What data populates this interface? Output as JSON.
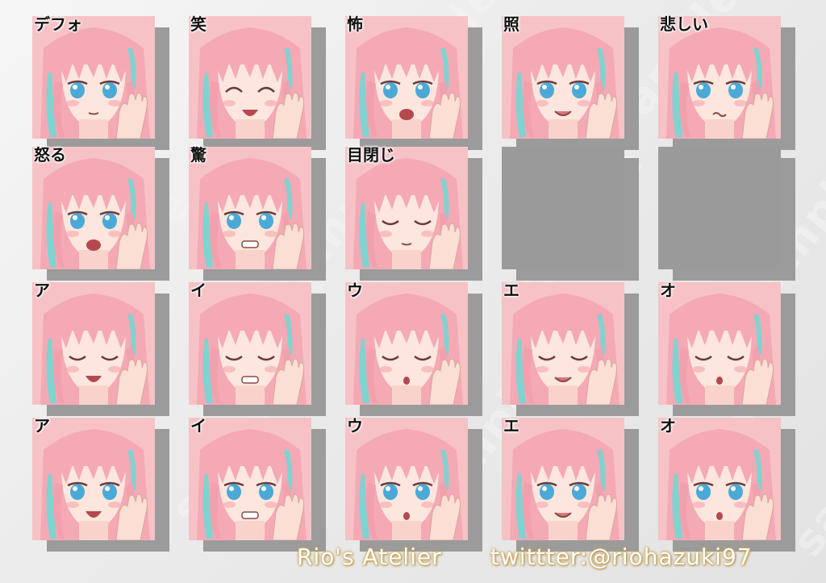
{
  "watermark_text": "sample",
  "faces": [
    {
      "label": "デフォ",
      "eyes": "open",
      "mouth": "small"
    },
    {
      "label": "笑",
      "eyes": "happy",
      "mouth": "open"
    },
    {
      "label": "怖",
      "eyes": "open",
      "mouth": "wide"
    },
    {
      "label": "照",
      "eyes": "open",
      "mouth": "smile"
    },
    {
      "label": "悲しい",
      "eyes": "open",
      "mouth": "wavy"
    },
    {
      "label": "怒る",
      "eyes": "open",
      "mouth": "wide"
    },
    {
      "label": "驚",
      "eyes": "open",
      "mouth": "teeth"
    },
    {
      "label": "目閉じ",
      "eyes": "closed",
      "mouth": "small"
    },
    {
      "label": "",
      "blank": true
    },
    {
      "label": "",
      "blank": true
    },
    {
      "label": "ア",
      "eyes": "closed",
      "mouth": "open"
    },
    {
      "label": "イ",
      "eyes": "closed",
      "mouth": "teeth"
    },
    {
      "label": "ウ",
      "eyes": "closed",
      "mouth": "o"
    },
    {
      "label": "エ",
      "eyes": "closed",
      "mouth": "smile"
    },
    {
      "label": "オ",
      "eyes": "closed",
      "mouth": "o"
    },
    {
      "label": "ア",
      "eyes": "open",
      "mouth": "open"
    },
    {
      "label": "イ",
      "eyes": "open",
      "mouth": "teeth"
    },
    {
      "label": "ウ",
      "eyes": "open",
      "mouth": "o"
    },
    {
      "label": "エ",
      "eyes": "open",
      "mouth": "smile"
    },
    {
      "label": "オ",
      "eyes": "open",
      "mouth": "o"
    }
  ],
  "footer": {
    "brand": "Rio's Atelier",
    "twitter": "twittter:@riohazuki97"
  },
  "colors": {
    "hair": "#f4a9b5",
    "hair_highlight": "#7fd3d0",
    "skin": "#fde6dd",
    "eye": "#4aa9d6",
    "blank_tile": "#9a9a9a"
  }
}
